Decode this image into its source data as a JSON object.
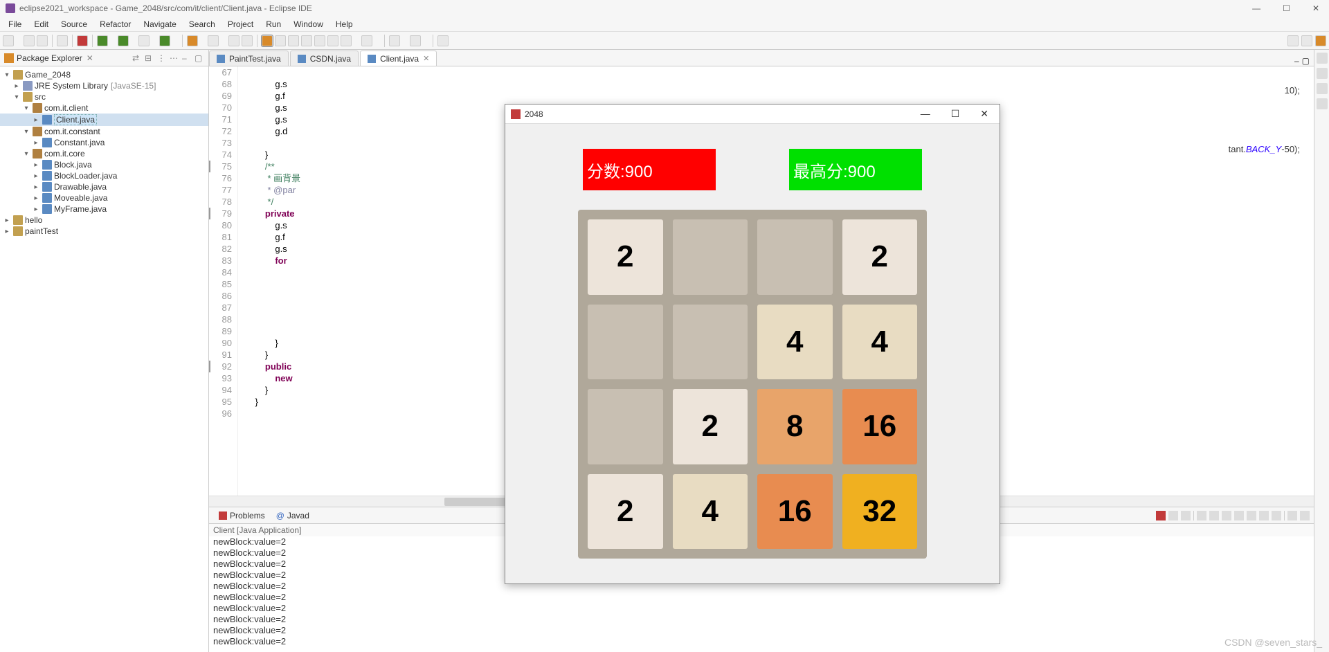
{
  "window": {
    "title": "eclipse2021_workspace - Game_2048/src/com/it/client/Client.java - Eclipse IDE",
    "min": "—",
    "max": "☐",
    "close": "✕"
  },
  "menu": [
    "File",
    "Edit",
    "Source",
    "Refactor",
    "Navigate",
    "Search",
    "Project",
    "Run",
    "Window",
    "Help"
  ],
  "pkgexp": {
    "title": "Package Explorer",
    "projects": {
      "game": "Game_2048",
      "jre": "JRE System Library",
      "jreExtra": "[JavaSE-15]",
      "src": "src",
      "p_client": "com.it.client",
      "f_client": "Client.java",
      "p_constant": "com.it.constant",
      "f_constant": "Constant.java",
      "p_core": "com.it.core",
      "f_block": "Block.java",
      "f_blockloader": "BlockLoader.java",
      "f_drawable": "Drawable.java",
      "f_moveable": "Moveable.java",
      "f_myframe": "MyFrame.java",
      "hello": "hello",
      "paint": "paintTest"
    }
  },
  "tabs": [
    {
      "label": "PaintTest.java"
    },
    {
      "label": "CSDN.java"
    },
    {
      "label": "Client.java"
    }
  ],
  "code": {
    "lines": [
      "67",
      "68",
      "69",
      "70",
      "71",
      "72",
      "73",
      "74",
      "75",
      "76",
      "77",
      "78",
      "79",
      "80",
      "81",
      "82",
      "83",
      "84",
      "85",
      "86",
      "87",
      "88",
      "89",
      "90",
      "91",
      "92",
      "93",
      "94",
      "95",
      "96"
    ],
    "l68": "            g.s",
    "l69": "            g.f",
    "l70": "            g.s",
    "l71": "            g.s",
    "l72": "            g.d",
    "l74": "        }",
    "l75": "        /**",
    "l76": "         * 画背景",
    "l77": "         * @par",
    "l78": "         */",
    "l79": "        private",
    "l80": "            g.s",
    "l81": "            g.f",
    "l82": "            g.s",
    "l83": "            for",
    "l90": "            }",
    "l91": "        }",
    "l92": "        public",
    "l93": "            new",
    "l94": "        }",
    "l95": "    }",
    "r68": "10);",
    "r72": "tant.BACK_Y-50);"
  },
  "console": {
    "tab1": "Problems",
    "tab2": "Javad",
    "head": "Client [Java Application]",
    "lines": [
      "newBlock:value=2",
      "newBlock:value=2",
      "newBlock:value=2",
      "newBlock:value=2",
      "newBlock:value=2",
      "newBlock:value=2",
      "newBlock:value=2",
      "newBlock:value=2",
      "newBlock:value=2",
      "newBlock:value=2"
    ]
  },
  "game": {
    "title": "2048",
    "score_label": "分数:900",
    "high_label": "最高分:900",
    "board": [
      "2",
      "",
      "",
      "2",
      "",
      "",
      "4",
      "4",
      "",
      "2",
      "8",
      "16",
      "2",
      "4",
      "16",
      "32"
    ]
  },
  "watermark": "CSDN @seven_stars_"
}
